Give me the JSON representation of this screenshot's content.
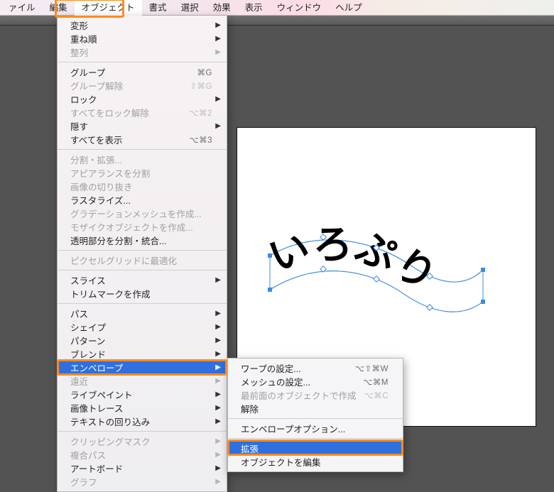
{
  "menubar": {
    "items": [
      {
        "label": "ァイル"
      },
      {
        "label": "編集"
      },
      {
        "label": "オブジェクト"
      },
      {
        "label": "書式"
      },
      {
        "label": "選択"
      },
      {
        "label": "効果"
      },
      {
        "label": "表示"
      },
      {
        "label": "ウィンドウ"
      },
      {
        "label": "ヘルプ"
      }
    ],
    "open_index": 2
  },
  "dropdown": [
    {
      "type": "item",
      "label": "変形",
      "submenu": true
    },
    {
      "type": "item",
      "label": "重ね順",
      "submenu": true
    },
    {
      "type": "item",
      "label": "整列",
      "submenu": true,
      "disabled": true
    },
    {
      "type": "sep"
    },
    {
      "type": "item",
      "label": "グループ",
      "shortcut": "⌘G"
    },
    {
      "type": "item",
      "label": "グループ解除",
      "shortcut": "⇧⌘G",
      "disabled": true
    },
    {
      "type": "item",
      "label": "ロック",
      "submenu": true
    },
    {
      "type": "item",
      "label": "すべてをロック解除",
      "shortcut": "⌥⌘2",
      "disabled": true
    },
    {
      "type": "item",
      "label": "隠す",
      "submenu": true
    },
    {
      "type": "item",
      "label": "すべてを表示",
      "shortcut": "⌥⌘3"
    },
    {
      "type": "sep"
    },
    {
      "type": "item",
      "label": "分割・拡張...",
      "disabled": true
    },
    {
      "type": "item",
      "label": "アピアランスを分割",
      "disabled": true
    },
    {
      "type": "item",
      "label": "画像の切り抜き",
      "disabled": true
    },
    {
      "type": "item",
      "label": "ラスタライズ..."
    },
    {
      "type": "item",
      "label": "グラデーションメッシュを作成...",
      "disabled": true
    },
    {
      "type": "item",
      "label": "モザイクオブジェクトを作成...",
      "disabled": true
    },
    {
      "type": "item",
      "label": "透明部分を分割・統合..."
    },
    {
      "type": "sep"
    },
    {
      "type": "item",
      "label": "ピクセルグリッドに最適化",
      "disabled": true
    },
    {
      "type": "sep"
    },
    {
      "type": "item",
      "label": "スライス",
      "submenu": true
    },
    {
      "type": "item",
      "label": "トリムマークを作成"
    },
    {
      "type": "sep"
    },
    {
      "type": "item",
      "label": "パス",
      "submenu": true
    },
    {
      "type": "item",
      "label": "シェイプ",
      "submenu": true
    },
    {
      "type": "item",
      "label": "パターン",
      "submenu": true
    },
    {
      "type": "item",
      "label": "ブレンド",
      "submenu": true
    },
    {
      "type": "item",
      "label": "エンベロープ",
      "submenu": true,
      "selected": true
    },
    {
      "type": "item",
      "label": "遠近",
      "submenu": true,
      "disabled": true
    },
    {
      "type": "item",
      "label": "ライブペイント",
      "submenu": true
    },
    {
      "type": "item",
      "label": "画像トレース",
      "submenu": true
    },
    {
      "type": "item",
      "label": "テキストの回り込み",
      "submenu": true
    },
    {
      "type": "sep"
    },
    {
      "type": "item",
      "label": "クリッピングマスク",
      "submenu": true,
      "disabled": true
    },
    {
      "type": "item",
      "label": "複合パス",
      "submenu": true,
      "disabled": true
    },
    {
      "type": "item",
      "label": "アートボード",
      "submenu": true
    },
    {
      "type": "item",
      "label": "グラフ",
      "submenu": true,
      "disabled": true
    }
  ],
  "submenu": [
    {
      "type": "item",
      "label": "ワープの設定...",
      "shortcut": "⌥⇧⌘W"
    },
    {
      "type": "item",
      "label": "メッシュの設定...",
      "shortcut": "⌥⌘M"
    },
    {
      "type": "item",
      "label": "最前面のオブジェクトで作成",
      "shortcut": "⌥⌘C",
      "disabled": true
    },
    {
      "type": "item",
      "label": "解除"
    },
    {
      "type": "sep"
    },
    {
      "type": "item",
      "label": "エンベロープオプション..."
    },
    {
      "type": "sep"
    },
    {
      "type": "item",
      "label": "拡張",
      "selected": true
    },
    {
      "type": "item",
      "label": "オブジェクトを編集"
    }
  ],
  "canvas": {
    "text": "いろぷり"
  },
  "colors": {
    "selection": "#2f6fe0",
    "highlight": "#ff8b1f"
  }
}
